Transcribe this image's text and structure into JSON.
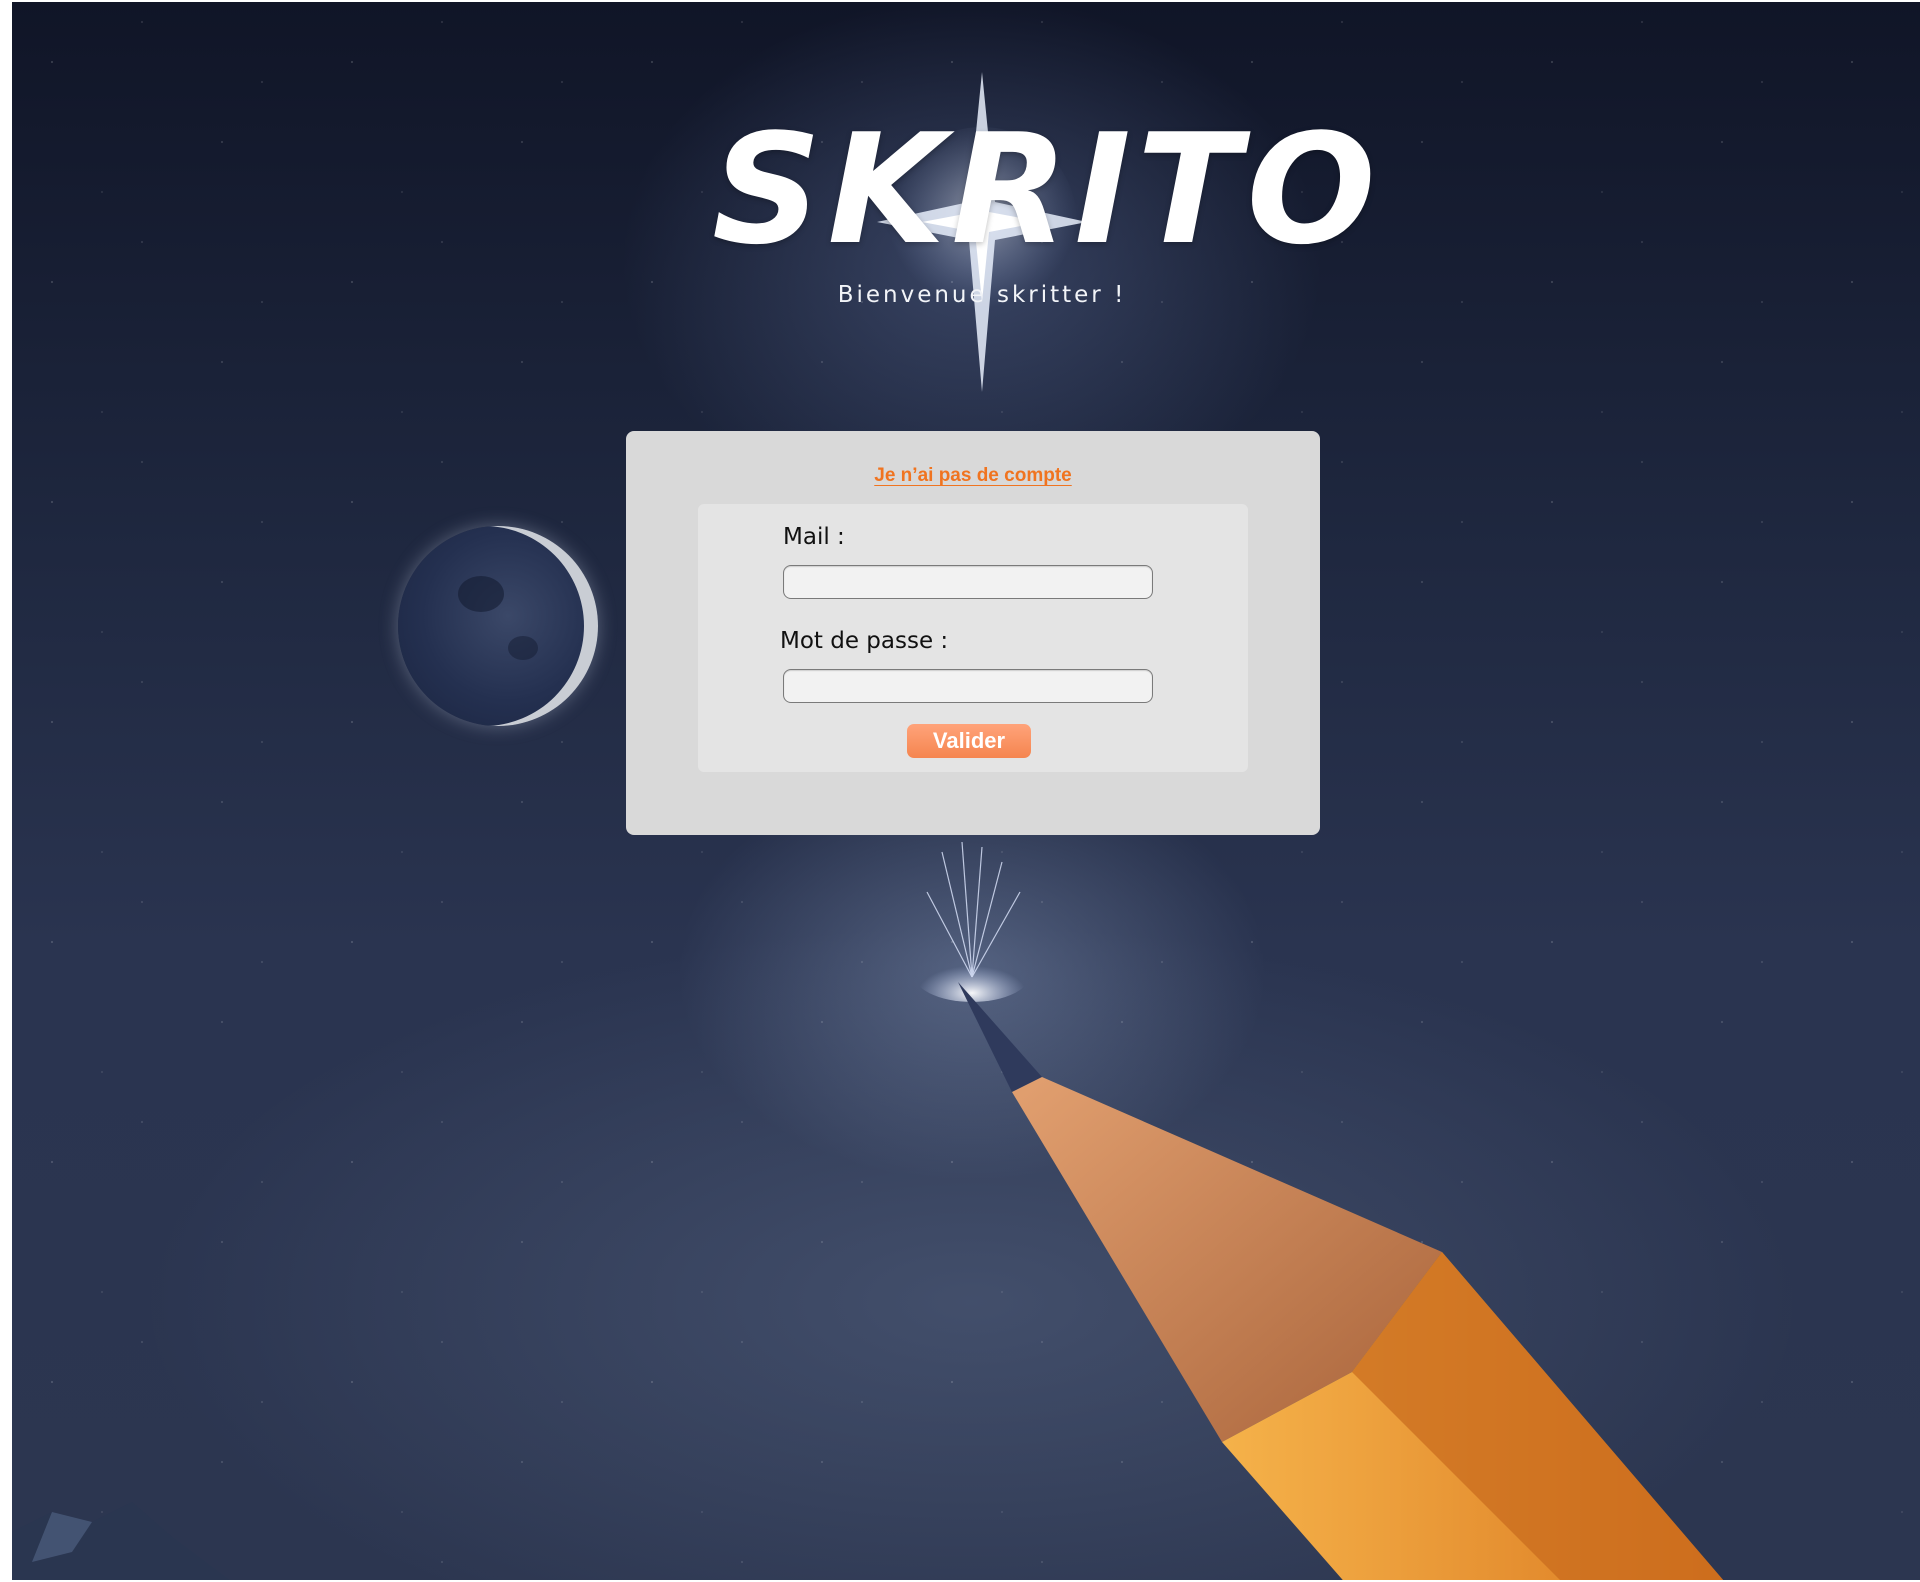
{
  "app": {
    "logo_text": "SKRITO",
    "subtitle": "Bienvenue skritter !"
  },
  "login": {
    "signup_link": "Je n’ai pas de compte",
    "mail_label": "Mail :",
    "mail_value": "",
    "password_label": "Mot de passe :",
    "password_value": "",
    "submit_label": "Valider"
  },
  "colors": {
    "accent": "#f07420",
    "button": "#f5854f",
    "panel": "#d9d9d9",
    "form": "#e4e4e4"
  }
}
